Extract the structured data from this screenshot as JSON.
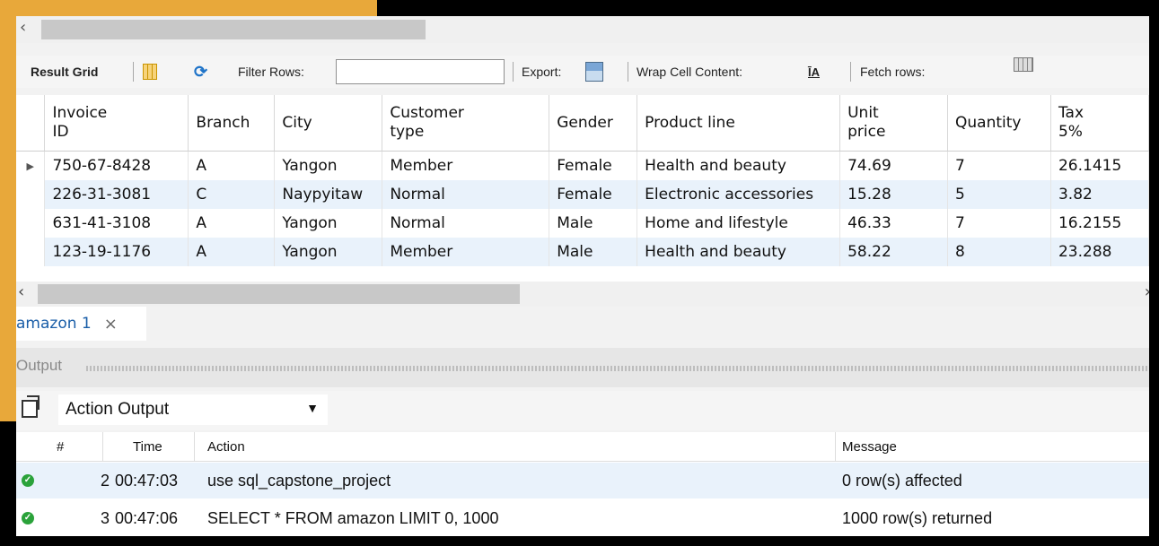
{
  "result_toolbar": {
    "result_grid": "Result Grid",
    "filter_rows": "Filter Rows:",
    "export": "Export:",
    "wrap_cell_content": "Wrap Cell Content:",
    "fetch_rows": "Fetch rows:"
  },
  "grid": {
    "headers": [
      "Invoice\nID",
      "Branch",
      "City",
      "Customer\ntype",
      "Gender",
      "Product line",
      "Unit\nprice",
      "Quantity",
      "Tax\n5%"
    ],
    "header_display": [
      [
        "Invoice",
        "ID"
      ],
      [
        "Branch"
      ],
      [
        "City"
      ],
      [
        "Customer",
        "type"
      ],
      [
        "Gender"
      ],
      [
        "Product line"
      ],
      [
        "Unit",
        "price"
      ],
      [
        "Quantity"
      ],
      [
        "Tax",
        "5%"
      ]
    ],
    "rows": [
      [
        "750-67-8428",
        "A",
        "Yangon",
        "Member",
        "Female",
        "Health and beauty",
        "74.69",
        "7",
        "26.1415"
      ],
      [
        "226-31-3081",
        "C",
        "Naypyitaw",
        "Normal",
        "Female",
        "Electronic accessories",
        "15.28",
        "5",
        "3.82"
      ],
      [
        "631-41-3108",
        "A",
        "Yangon",
        "Normal",
        "Male",
        "Home and lifestyle",
        "46.33",
        "7",
        "16.2155"
      ],
      [
        "123-19-1176",
        "A",
        "Yangon",
        "Member",
        "Male",
        "Health and beauty",
        "58.22",
        "8",
        "23.288"
      ]
    ]
  },
  "tabs": [
    {
      "label": "amazon 1",
      "close": "×"
    }
  ],
  "output": {
    "label": "Output",
    "selector_value": "Action Output",
    "columns": {
      "num": "#",
      "time": "Time",
      "action": "Action",
      "message": "Message"
    },
    "rows": [
      {
        "num": "2",
        "time": "00:47:03",
        "action": "use sql_capstone_project",
        "message": "0 row(s) affected",
        "status": "success"
      },
      {
        "num": "3",
        "time": "00:47:06",
        "action": "SELECT * FROM amazon LIMIT 0, 1000",
        "message": "1000 row(s) returned",
        "status": "success"
      }
    ]
  },
  "colors": {
    "accent_frame": "#e8a83a",
    "row_alt": "#e9f2fb",
    "success": "#2aa23a",
    "tab_text": "#1a5ea8"
  }
}
